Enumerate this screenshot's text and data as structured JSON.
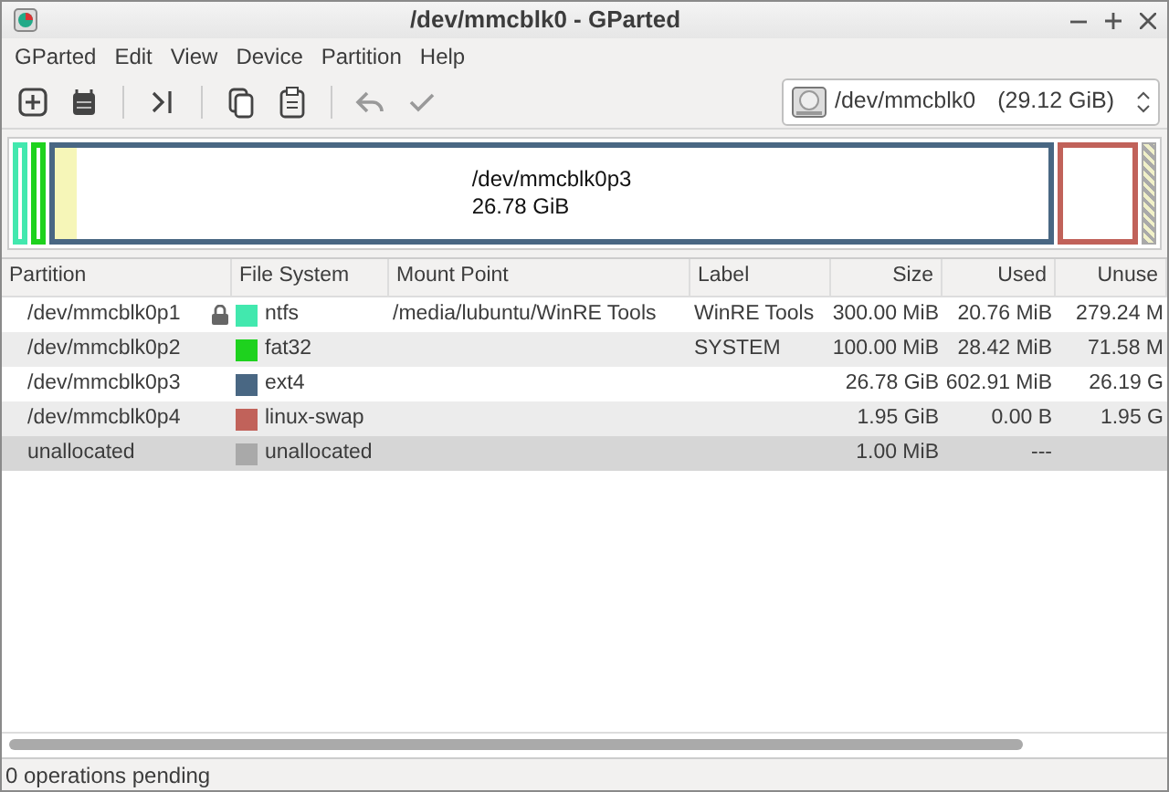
{
  "window": {
    "title": "/dev/mmcblk0 - GParted"
  },
  "menu": [
    "GParted",
    "Edit",
    "View",
    "Device",
    "Partition",
    "Help"
  ],
  "toolbar": [
    {
      "kind": "new",
      "disabled": false
    },
    {
      "kind": "delete",
      "disabled": false
    },
    {
      "kind": "sep"
    },
    {
      "kind": "resize",
      "disabled": false
    },
    {
      "kind": "sep"
    },
    {
      "kind": "copy",
      "disabled": false
    },
    {
      "kind": "paste",
      "disabled": false
    },
    {
      "kind": "sep"
    },
    {
      "kind": "undo",
      "disabled": true
    },
    {
      "kind": "apply",
      "disabled": true
    }
  ],
  "device": {
    "name": "/dev/mmcblk0",
    "size": "(29.12 GiB)"
  },
  "disk_map": [
    {
      "kind": "part",
      "color": "#42e8ae"
    },
    {
      "kind": "part",
      "color": "#1ed21e"
    },
    {
      "kind": "part",
      "color": "#496783",
      "level": 0.022,
      "name": "/dev/mmcblk0p3",
      "size": "26.78 GiB"
    },
    {
      "kind": "part",
      "color": "#c1625a"
    },
    {
      "kind": "unallocated",
      "color": "#a9a9a9"
    }
  ],
  "table": {
    "columns": [
      "Partition",
      "File System",
      "Mount Point",
      "Label",
      "Size",
      "Used",
      "Unuse"
    ],
    "rows": [
      {
        "partition": "/dev/mmcblk0p1",
        "locked": true,
        "color": "#42e8ae",
        "filesystem": "ntfs",
        "mount": "/media/lubuntu/WinRE Tools",
        "label": "WinRE Tools",
        "size": "300.00 MiB",
        "used": "20.76 MiB",
        "unused": "279.24 M",
        "selected": false
      },
      {
        "partition": "/dev/mmcblk0p2",
        "locked": false,
        "color": "#1ed21e",
        "filesystem": "fat32",
        "label": "SYSTEM",
        "size": "100.00 MiB",
        "used": "28.42 MiB",
        "unused": "71.58 M",
        "selected": false
      },
      {
        "partition": "/dev/mmcblk0p3",
        "locked": false,
        "color": "#496783",
        "filesystem": "ext4",
        "size": "26.78 GiB",
        "used": "602.91 MiB",
        "unused": "26.19 G",
        "selected": false
      },
      {
        "partition": "/dev/mmcblk0p4",
        "locked": false,
        "color": "#c1625a",
        "filesystem": "linux-swap",
        "size": "1.95 GiB",
        "used": "0.00 B",
        "unused": "1.95 G",
        "selected": false
      },
      {
        "partition": "unallocated",
        "locked": false,
        "color": "#a9a9a9",
        "filesystem": "unallocated",
        "size": "1.00 MiB",
        "used": "---",
        "selected": true
      }
    ]
  },
  "status_bar": "0 operations pending"
}
